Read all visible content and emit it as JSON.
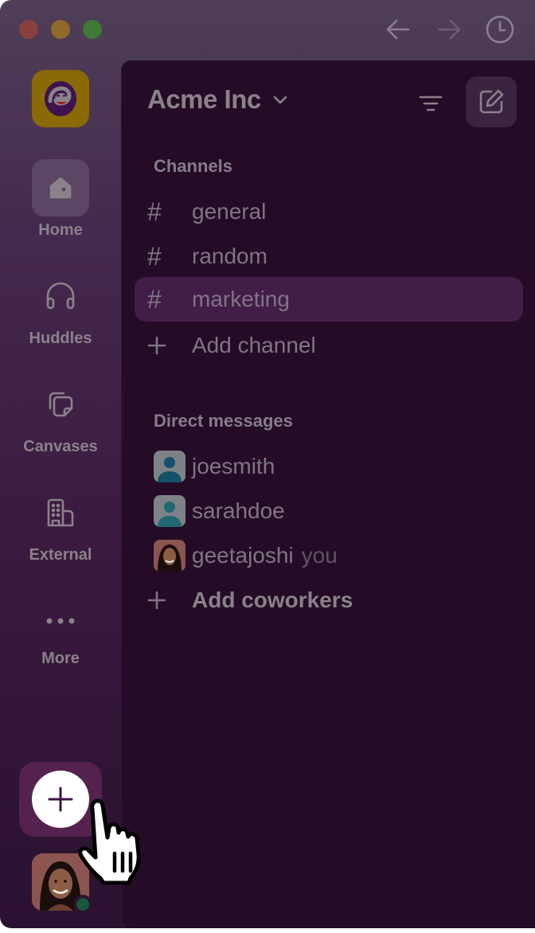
{
  "window": {
    "controls": [
      "close",
      "minimize",
      "maximize"
    ],
    "nav": {
      "back_icon": "arrow-left-icon",
      "forward_icon": "arrow-right-icon",
      "history_icon": "clock-icon"
    }
  },
  "rail": {
    "workspace_logo_icon": "sloth-logo-icon",
    "items": [
      {
        "label": "Home",
        "icon": "home-icon",
        "active": true
      },
      {
        "label": "Huddles",
        "icon": "headphones-icon",
        "active": false
      },
      {
        "label": "Canvases",
        "icon": "canvas-icon",
        "active": false
      },
      {
        "label": "External",
        "icon": "building-icon",
        "active": false
      },
      {
        "label": "More",
        "icon": "more-icon",
        "active": false
      }
    ],
    "create_icon": "plus-icon",
    "user_status": "online"
  },
  "sidebar": {
    "workspace_name": "Acme Inc",
    "filter_icon": "filter-icon",
    "compose_icon": "compose-icon",
    "channels": {
      "title": "Channels",
      "items": [
        {
          "name": "general",
          "selected": false
        },
        {
          "name": "random",
          "selected": false
        },
        {
          "name": "marketing",
          "selected": true
        }
      ],
      "add_label": "Add channel"
    },
    "dms": {
      "title": "Direct messages",
      "items": [
        {
          "name": "joesmith",
          "suffix": "",
          "avatar": "default-avatar"
        },
        {
          "name": "sarahdoe",
          "suffix": "",
          "avatar": "default-avatar"
        },
        {
          "name": "geetajoshi",
          "suffix": "you",
          "avatar": "photo-avatar"
        }
      ],
      "add_label": "Add coworkers"
    }
  },
  "colors": {
    "panel_bg": "#240b26",
    "selected_row": "#421d47",
    "workspace_logo": "#8a6a06",
    "create_button": "#55224f",
    "presence": "#17573a"
  }
}
